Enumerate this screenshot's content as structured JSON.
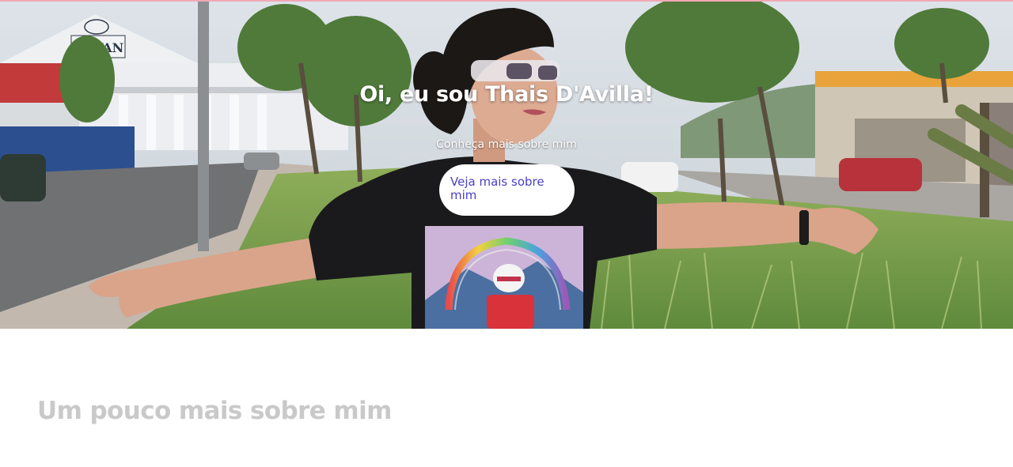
{
  "hero": {
    "title": "Oi, eu sou Thais D'Avilla!",
    "subtitle": "Conheça mais sobre mim",
    "button_label": "Veja mais sobre mim",
    "photo_sign_text": "HAVAN"
  },
  "about": {
    "heading": "Um pouco mais sobre mim"
  },
  "colors": {
    "button_text": "#4b3fc4",
    "heading_grey": "#c9c9c9",
    "top_line": "#f2a7b4"
  }
}
